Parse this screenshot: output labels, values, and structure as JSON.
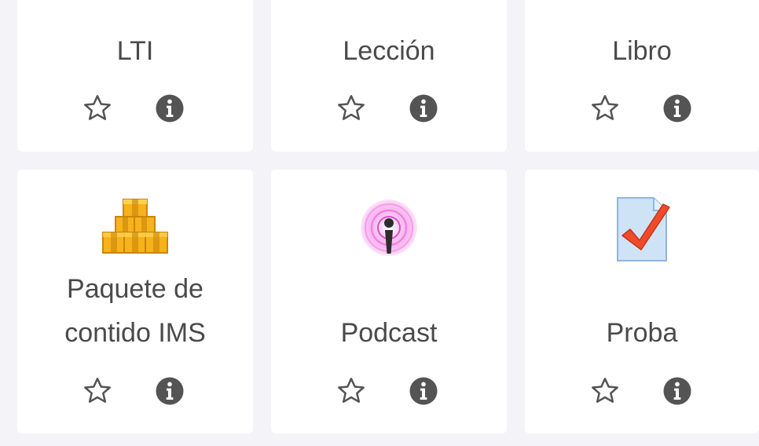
{
  "modules": [
    {
      "name": "LTI",
      "icon": "none"
    },
    {
      "name": "Lección",
      "icon": "none"
    },
    {
      "name": "Libro",
      "icon": "none"
    },
    {
      "name": "Paquete de contido IMS",
      "icon": "ims-package-icon"
    },
    {
      "name": "Podcast",
      "icon": "podcast-icon"
    },
    {
      "name": "Proba",
      "icon": "quiz-icon"
    }
  ],
  "colors": {
    "card_bg": "#ffffff",
    "page_bg": "#f4f4f8",
    "text": "#4a4a4a",
    "icon_gray": "#545454"
  }
}
